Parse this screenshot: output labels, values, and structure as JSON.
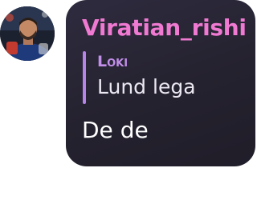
{
  "message": {
    "sender_name": "Viratian_rishi",
    "reply": {
      "author": "Loki",
      "text": "Lund lega"
    },
    "text": "De de"
  },
  "colors": {
    "bubble_background": "#26232f",
    "sender_name": "#f07ad2",
    "reply_accent": "#b784e8",
    "text": "#ffffff"
  }
}
